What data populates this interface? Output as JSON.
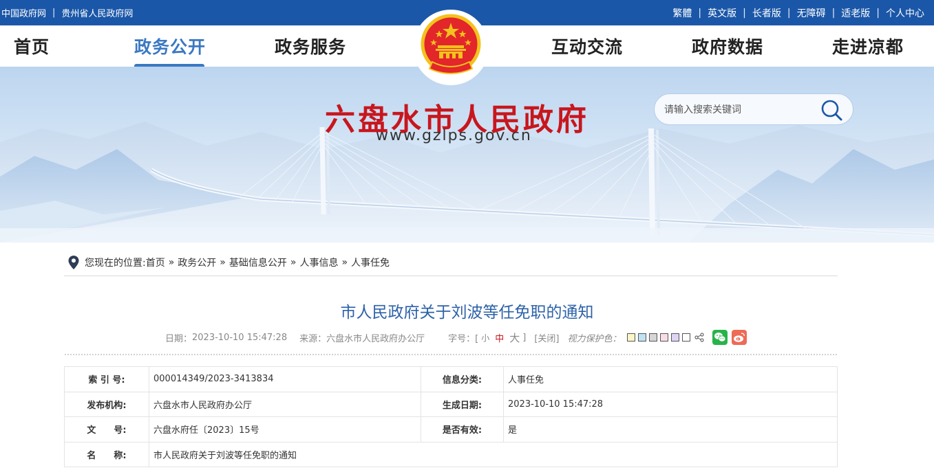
{
  "topbar": {
    "left_links": [
      "中国政府网",
      "贵州省人民政府网"
    ],
    "right_links": [
      "繁體",
      "英文版",
      "长者版",
      "无障碍",
      "适老版",
      "个人中心"
    ]
  },
  "nav": {
    "items": [
      "首页",
      "政务公开",
      "政务服务",
      "互动交流",
      "政府数据",
      "走进凉都"
    ],
    "active_index": 1
  },
  "banner": {
    "title": "六盘水市人民政府",
    "url": "www.gzlps.gov.cn"
  },
  "search": {
    "placeholder": "请输入搜索关键词"
  },
  "breadcrumb": {
    "prefix": "您现在的位置:",
    "items": [
      "首页",
      "政务公开",
      "基础信息公开",
      "人事信息",
      "人事任免"
    ],
    "separator": "»"
  },
  "article": {
    "title": "市人民政府关于刘波等任免职的通知",
    "date_label": "日期：",
    "date": "2023-10-10 15:47:28",
    "source_label": "来源：",
    "source": "六盘水市人民政府办公厅",
    "font_label": "字号：[",
    "font_small": "小",
    "font_medium": "中",
    "font_large": "大",
    "font_close": "]",
    "close_text": "[关闭]",
    "vision_label": "视力保护色："
  },
  "swatches": [
    "#fbf6c8",
    "#bfe3f2",
    "#d6d6d6",
    "#f9dce6",
    "#e0d4f4",
    "#ffffff"
  ],
  "info_table": {
    "rows": [
      {
        "l1": "索 引 号:",
        "v1": "000014349/2023-3413834",
        "l2": "信息分类:",
        "v2": "人事任免"
      },
      {
        "l1": "发布机构:",
        "v1": "六盘水市人民政府办公厅",
        "l2": "生成日期:",
        "v2": "2023-10-10 15:47:28"
      },
      {
        "l1": "文　　号:",
        "v1": "六盘水府任〔2023〕15号",
        "l2": "是否有效:",
        "v2": "是"
      }
    ],
    "name_label": "名　　称:",
    "name_value": "市人民政府关于刘波等任免职的通知"
  },
  "colors": {
    "topbar": "#1b57a8",
    "accent": "#3b78c2",
    "title_red": "#c8161d",
    "article_title": "#2d62a8"
  }
}
